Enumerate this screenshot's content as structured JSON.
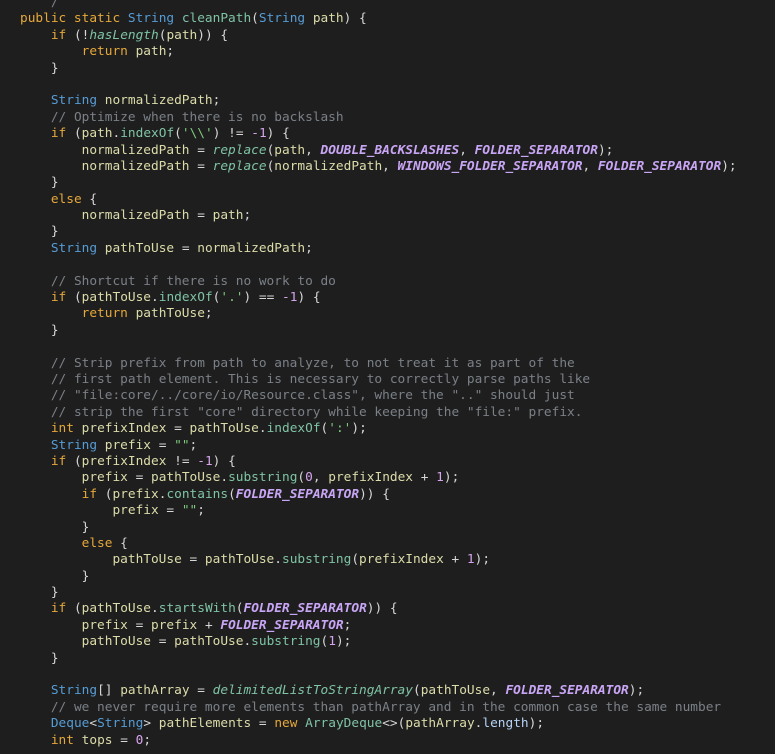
{
  "editor": {
    "lines": [
      [
        {
          "text": "    ",
          "type": "plain"
        },
        {
          "text": "/",
          "type": "comment"
        }
      ],
      [
        {
          "text": "public static ",
          "type": "kw"
        },
        {
          "text": "String ",
          "type": "type"
        },
        {
          "text": "cleanPath",
          "type": "method"
        },
        {
          "text": "(",
          "type": "punc"
        },
        {
          "text": "String ",
          "type": "type"
        },
        {
          "text": "path",
          "type": "var"
        },
        {
          "text": ") {",
          "type": "punc"
        }
      ],
      [
        {
          "text": "    ",
          "type": "plain"
        },
        {
          "text": "if ",
          "type": "kw"
        },
        {
          "text": "(!",
          "type": "punc"
        },
        {
          "text": "hasLength",
          "type": "method-italic"
        },
        {
          "text": "(",
          "type": "punc"
        },
        {
          "text": "path",
          "type": "var"
        },
        {
          "text": ")) {",
          "type": "punc"
        }
      ],
      [
        {
          "text": "        ",
          "type": "plain"
        },
        {
          "text": "return ",
          "type": "kw"
        },
        {
          "text": "path",
          "type": "var"
        },
        {
          "text": ";",
          "type": "punc"
        }
      ],
      [
        {
          "text": "    }",
          "type": "punc"
        }
      ],
      [],
      [
        {
          "text": "    ",
          "type": "plain"
        },
        {
          "text": "String ",
          "type": "type"
        },
        {
          "text": "normalizedPath",
          "type": "var"
        },
        {
          "text": ";",
          "type": "punc"
        }
      ],
      [
        {
          "text": "    ",
          "type": "plain"
        },
        {
          "text": "// Optimize when there is no backslash",
          "type": "comment"
        }
      ],
      [
        {
          "text": "    ",
          "type": "plain"
        },
        {
          "text": "if ",
          "type": "kw"
        },
        {
          "text": "(",
          "type": "punc"
        },
        {
          "text": "path",
          "type": "var"
        },
        {
          "text": ".",
          "type": "punc"
        },
        {
          "text": "indexOf",
          "type": "method"
        },
        {
          "text": "(",
          "type": "punc"
        },
        {
          "text": "'\\\\'",
          "type": "string"
        },
        {
          "text": ") != ",
          "type": "op"
        },
        {
          "text": "-1",
          "type": "number"
        },
        {
          "text": ") {",
          "type": "punc"
        }
      ],
      [
        {
          "text": "        ",
          "type": "plain"
        },
        {
          "text": "normalizedPath",
          "type": "var"
        },
        {
          "text": " = ",
          "type": "op"
        },
        {
          "text": "replace",
          "type": "method-italic"
        },
        {
          "text": "(",
          "type": "punc"
        },
        {
          "text": "path",
          "type": "var"
        },
        {
          "text": ", ",
          "type": "punc"
        },
        {
          "text": "DOUBLE_BACKSLASHES",
          "type": "const"
        },
        {
          "text": ", ",
          "type": "punc"
        },
        {
          "text": "FOLDER_SEPARATOR",
          "type": "const"
        },
        {
          "text": ");",
          "type": "punc"
        }
      ],
      [
        {
          "text": "        ",
          "type": "plain"
        },
        {
          "text": "normalizedPath",
          "type": "var"
        },
        {
          "text": " = ",
          "type": "op"
        },
        {
          "text": "replace",
          "type": "method-italic"
        },
        {
          "text": "(",
          "type": "punc"
        },
        {
          "text": "normalizedPath",
          "type": "var"
        },
        {
          "text": ", ",
          "type": "punc"
        },
        {
          "text": "WINDOWS_FOLDER_SEPARATOR",
          "type": "const"
        },
        {
          "text": ", ",
          "type": "punc"
        },
        {
          "text": "FOLDER_SEPARATOR",
          "type": "const"
        },
        {
          "text": ");",
          "type": "punc"
        }
      ],
      [
        {
          "text": "    }",
          "type": "punc"
        }
      ],
      [
        {
          "text": "    ",
          "type": "plain"
        },
        {
          "text": "else",
          "type": "kw"
        },
        {
          "text": " {",
          "type": "punc"
        }
      ],
      [
        {
          "text": "        ",
          "type": "plain"
        },
        {
          "text": "normalizedPath",
          "type": "var"
        },
        {
          "text": " = ",
          "type": "op"
        },
        {
          "text": "path",
          "type": "var"
        },
        {
          "text": ";",
          "type": "punc"
        }
      ],
      [
        {
          "text": "    }",
          "type": "punc"
        }
      ],
      [
        {
          "text": "    ",
          "type": "plain"
        },
        {
          "text": "String ",
          "type": "type"
        },
        {
          "text": "pathToUse",
          "type": "var"
        },
        {
          "text": " = ",
          "type": "op"
        },
        {
          "text": "normalizedPath",
          "type": "var"
        },
        {
          "text": ";",
          "type": "punc"
        }
      ],
      [],
      [
        {
          "text": "    ",
          "type": "plain"
        },
        {
          "text": "// Shortcut if there is no work to do",
          "type": "comment"
        }
      ],
      [
        {
          "text": "    ",
          "type": "plain"
        },
        {
          "text": "if ",
          "type": "kw"
        },
        {
          "text": "(",
          "type": "punc"
        },
        {
          "text": "pathToUse",
          "type": "var"
        },
        {
          "text": ".",
          "type": "punc"
        },
        {
          "text": "indexOf",
          "type": "method"
        },
        {
          "text": "(",
          "type": "punc"
        },
        {
          "text": "'.'",
          "type": "string"
        },
        {
          "text": ") == ",
          "type": "op"
        },
        {
          "text": "-1",
          "type": "number"
        },
        {
          "text": ") {",
          "type": "punc"
        }
      ],
      [
        {
          "text": "        ",
          "type": "plain"
        },
        {
          "text": "return ",
          "type": "kw"
        },
        {
          "text": "pathToUse",
          "type": "var"
        },
        {
          "text": ";",
          "type": "punc"
        }
      ],
      [
        {
          "text": "    }",
          "type": "punc"
        }
      ],
      [],
      [
        {
          "text": "    ",
          "type": "plain"
        },
        {
          "text": "// Strip prefix from path to analyze, to not treat it as part of the",
          "type": "comment"
        }
      ],
      [
        {
          "text": "    ",
          "type": "plain"
        },
        {
          "text": "// first path element. This is necessary to correctly parse paths like",
          "type": "comment"
        }
      ],
      [
        {
          "text": "    ",
          "type": "plain"
        },
        {
          "text": "// \"file:core/../core/io/Resource.class\", where the \"..\" should just",
          "type": "comment"
        }
      ],
      [
        {
          "text": "    ",
          "type": "plain"
        },
        {
          "text": "// strip the first \"core\" directory while keeping the \"file:\" prefix.",
          "type": "comment"
        }
      ],
      [
        {
          "text": "    ",
          "type": "plain"
        },
        {
          "text": "int ",
          "type": "kw"
        },
        {
          "text": "prefixIndex",
          "type": "var"
        },
        {
          "text": " = ",
          "type": "op"
        },
        {
          "text": "pathToUse",
          "type": "var"
        },
        {
          "text": ".",
          "type": "punc"
        },
        {
          "text": "indexOf",
          "type": "method"
        },
        {
          "text": "(",
          "type": "punc"
        },
        {
          "text": "':'",
          "type": "string"
        },
        {
          "text": ");",
          "type": "punc"
        }
      ],
      [
        {
          "text": "    ",
          "type": "plain"
        },
        {
          "text": "String ",
          "type": "type"
        },
        {
          "text": "prefix",
          "type": "var"
        },
        {
          "text": " = ",
          "type": "op"
        },
        {
          "text": "\"\"",
          "type": "string"
        },
        {
          "text": ";",
          "type": "punc"
        }
      ],
      [
        {
          "text": "    ",
          "type": "plain"
        },
        {
          "text": "if ",
          "type": "kw"
        },
        {
          "text": "(",
          "type": "punc"
        },
        {
          "text": "prefixIndex",
          "type": "var"
        },
        {
          "text": " != ",
          "type": "op"
        },
        {
          "text": "-1",
          "type": "number"
        },
        {
          "text": ") {",
          "type": "punc"
        }
      ],
      [
        {
          "text": "        ",
          "type": "plain"
        },
        {
          "text": "prefix",
          "type": "var"
        },
        {
          "text": " = ",
          "type": "op"
        },
        {
          "text": "pathToUse",
          "type": "var"
        },
        {
          "text": ".",
          "type": "punc"
        },
        {
          "text": "substring",
          "type": "method"
        },
        {
          "text": "(",
          "type": "punc"
        },
        {
          "text": "0",
          "type": "number"
        },
        {
          "text": ", ",
          "type": "punc"
        },
        {
          "text": "prefixIndex",
          "type": "var"
        },
        {
          "text": " + ",
          "type": "op"
        },
        {
          "text": "1",
          "type": "number"
        },
        {
          "text": ");",
          "type": "punc"
        }
      ],
      [
        {
          "text": "        ",
          "type": "plain"
        },
        {
          "text": "if ",
          "type": "kw"
        },
        {
          "text": "(",
          "type": "punc"
        },
        {
          "text": "prefix",
          "type": "var"
        },
        {
          "text": ".",
          "type": "punc"
        },
        {
          "text": "contains",
          "type": "method"
        },
        {
          "text": "(",
          "type": "punc"
        },
        {
          "text": "FOLDER_SEPARATOR",
          "type": "const"
        },
        {
          "text": ")) {",
          "type": "punc"
        }
      ],
      [
        {
          "text": "            ",
          "type": "plain"
        },
        {
          "text": "prefix",
          "type": "var"
        },
        {
          "text": " = ",
          "type": "op"
        },
        {
          "text": "\"\"",
          "type": "string"
        },
        {
          "text": ";",
          "type": "punc"
        }
      ],
      [
        {
          "text": "        }",
          "type": "punc"
        }
      ],
      [
        {
          "text": "        ",
          "type": "plain"
        },
        {
          "text": "else",
          "type": "kw"
        },
        {
          "text": " {",
          "type": "punc"
        }
      ],
      [
        {
          "text": "            ",
          "type": "plain"
        },
        {
          "text": "pathToUse",
          "type": "var"
        },
        {
          "text": " = ",
          "type": "op"
        },
        {
          "text": "pathToUse",
          "type": "var"
        },
        {
          "text": ".",
          "type": "punc"
        },
        {
          "text": "substring",
          "type": "method"
        },
        {
          "text": "(",
          "type": "punc"
        },
        {
          "text": "prefixIndex",
          "type": "var"
        },
        {
          "text": " + ",
          "type": "op"
        },
        {
          "text": "1",
          "type": "number"
        },
        {
          "text": ");",
          "type": "punc"
        }
      ],
      [
        {
          "text": "        }",
          "type": "punc"
        }
      ],
      [
        {
          "text": "    }",
          "type": "punc"
        }
      ],
      [
        {
          "text": "    ",
          "type": "plain"
        },
        {
          "text": "if ",
          "type": "kw"
        },
        {
          "text": "(",
          "type": "punc"
        },
        {
          "text": "pathToUse",
          "type": "var"
        },
        {
          "text": ".",
          "type": "punc"
        },
        {
          "text": "startsWith",
          "type": "method"
        },
        {
          "text": "(",
          "type": "punc"
        },
        {
          "text": "FOLDER_SEPARATOR",
          "type": "const"
        },
        {
          "text": ")) {",
          "type": "punc"
        }
      ],
      [
        {
          "text": "        ",
          "type": "plain"
        },
        {
          "text": "prefix",
          "type": "var"
        },
        {
          "text": " = ",
          "type": "op"
        },
        {
          "text": "prefix",
          "type": "var"
        },
        {
          "text": " + ",
          "type": "op"
        },
        {
          "text": "FOLDER_SEPARATOR",
          "type": "const"
        },
        {
          "text": ";",
          "type": "punc"
        }
      ],
      [
        {
          "text": "        ",
          "type": "plain"
        },
        {
          "text": "pathToUse",
          "type": "var"
        },
        {
          "text": " = ",
          "type": "op"
        },
        {
          "text": "pathToUse",
          "type": "var"
        },
        {
          "text": ".",
          "type": "punc"
        },
        {
          "text": "substring",
          "type": "method"
        },
        {
          "text": "(",
          "type": "punc"
        },
        {
          "text": "1",
          "type": "number"
        },
        {
          "text": ");",
          "type": "punc"
        }
      ],
      [
        {
          "text": "    }",
          "type": "punc"
        }
      ],
      [],
      [
        {
          "text": "    ",
          "type": "plain"
        },
        {
          "text": "String",
          "type": "type"
        },
        {
          "text": "[] ",
          "type": "punc"
        },
        {
          "text": "pathArray",
          "type": "var"
        },
        {
          "text": " = ",
          "type": "op"
        },
        {
          "text": "delimitedListToStringArray",
          "type": "method-italic"
        },
        {
          "text": "(",
          "type": "punc"
        },
        {
          "text": "pathToUse",
          "type": "var"
        },
        {
          "text": ", ",
          "type": "punc"
        },
        {
          "text": "FOLDER_SEPARATOR",
          "type": "const"
        },
        {
          "text": ");",
          "type": "punc"
        }
      ],
      [
        {
          "text": "    ",
          "type": "plain"
        },
        {
          "text": "// we never require more elements than pathArray and in the common case the same number",
          "type": "comment"
        }
      ],
      [
        {
          "text": "    ",
          "type": "plain"
        },
        {
          "text": "Deque",
          "type": "type"
        },
        {
          "text": "<",
          "type": "punc"
        },
        {
          "text": "String",
          "type": "type"
        },
        {
          "text": "> ",
          "type": "punc"
        },
        {
          "text": "pathElements",
          "type": "var"
        },
        {
          "text": " = ",
          "type": "op"
        },
        {
          "text": "new ",
          "type": "kw"
        },
        {
          "text": "ArrayDeque",
          "type": "method"
        },
        {
          "text": "<>(",
          "type": "punc"
        },
        {
          "text": "pathArray",
          "type": "var"
        },
        {
          "text": ".",
          "type": "punc"
        },
        {
          "text": "length",
          "type": "field"
        },
        {
          "text": ");",
          "type": "punc"
        }
      ],
      [
        {
          "text": "    ",
          "type": "plain"
        },
        {
          "text": "int ",
          "type": "kw"
        },
        {
          "text": "tops",
          "type": "var"
        },
        {
          "text": " = ",
          "type": "op"
        },
        {
          "text": "0",
          "type": "number"
        },
        {
          "text": ";",
          "type": "punc"
        }
      ]
    ]
  },
  "colors": {
    "background": "#1e1e1e",
    "keyword": "#e5a83a",
    "type": "#569cd6",
    "method": "#7fc3a5",
    "constant": "#c9a6f5",
    "variable": "#dcdcaa",
    "string": "#7ec97e",
    "number": "#d7a4ee",
    "comment": "#7b8087"
  }
}
